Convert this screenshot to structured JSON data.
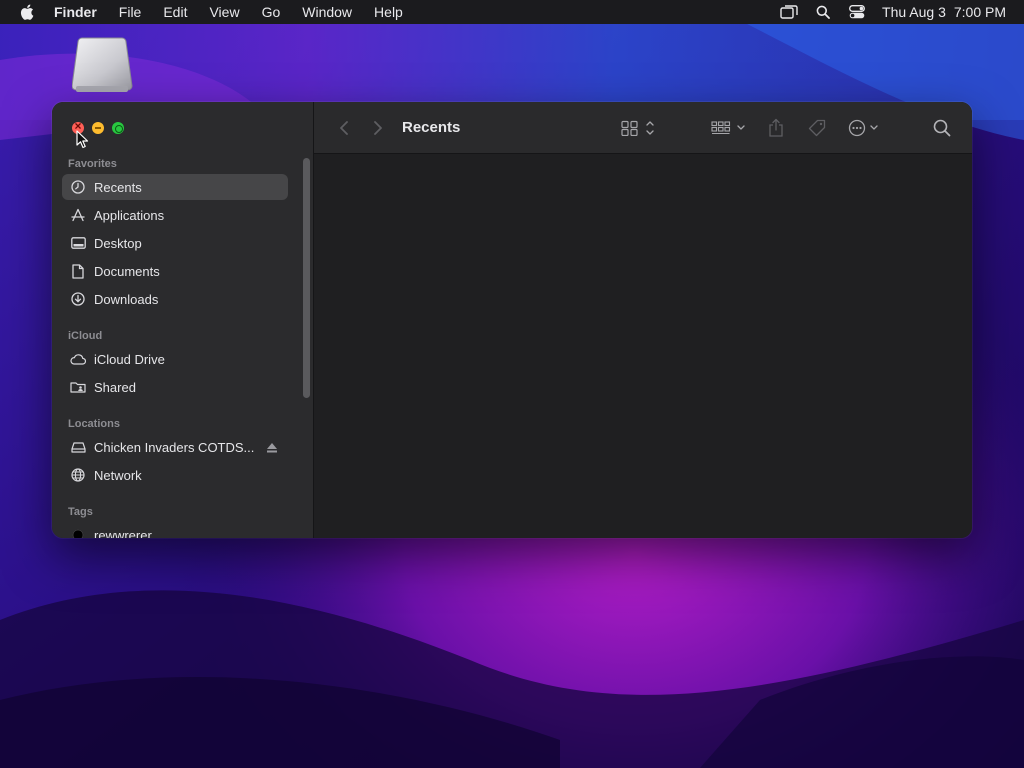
{
  "menubar": {
    "apple_icon": "apple-logo-icon",
    "app_name": "Finder",
    "menus": [
      "File",
      "Edit",
      "View",
      "Go",
      "Window",
      "Help"
    ],
    "status_icons": [
      "screen-mirroring-icon",
      "spotlight-search-icon",
      "control-center-icon"
    ],
    "clock": {
      "date": "Thu Aug 3",
      "time": "7:00 PM"
    }
  },
  "desktop": {
    "drive_icon": "external-drive-icon"
  },
  "finder": {
    "title": "Recents",
    "traffic_lights": [
      "close",
      "minimize",
      "zoom"
    ],
    "sidebar": {
      "favorites_title": "Favorites",
      "favorites": [
        {
          "label": "Recents",
          "icon": "clock-icon",
          "selected": true
        },
        {
          "label": "Applications",
          "icon": "applications-icon"
        },
        {
          "label": "Desktop",
          "icon": "desktop-icon"
        },
        {
          "label": "Documents",
          "icon": "document-icon"
        },
        {
          "label": "Downloads",
          "icon": "download-icon"
        }
      ],
      "icloud_title": "iCloud",
      "icloud": [
        {
          "label": "iCloud Drive",
          "icon": "cloud-icon"
        },
        {
          "label": "Shared",
          "icon": "shared-folder-icon"
        }
      ],
      "locations_title": "Locations",
      "locations": [
        {
          "label": "Chicken Invaders COTDS...",
          "icon": "disk-icon",
          "eject_icon": "eject-icon"
        },
        {
          "label": "Network",
          "icon": "network-globe-icon"
        }
      ],
      "tags_title": "Tags",
      "tags": [
        {
          "label": "rewwrerer",
          "color": "#000000"
        }
      ]
    },
    "toolbar": {
      "back_icon": "chevron-left-icon",
      "forward_icon": "chevron-right-icon",
      "view_icon": "grid-view-icon",
      "group_icon": "group-by-icon",
      "share_icon": "share-icon",
      "tag_icon": "tag-icon",
      "action_icon": "more-actions-icon",
      "search_icon": "search-icon"
    }
  },
  "colors": {
    "menubar": "#1b1b1e",
    "sidebar": "#2b2b2d",
    "content": "#1f1f21",
    "selection": "#464648",
    "close": "#ff5f57",
    "minimize": "#febc2e",
    "zoom": "#28c840"
  }
}
